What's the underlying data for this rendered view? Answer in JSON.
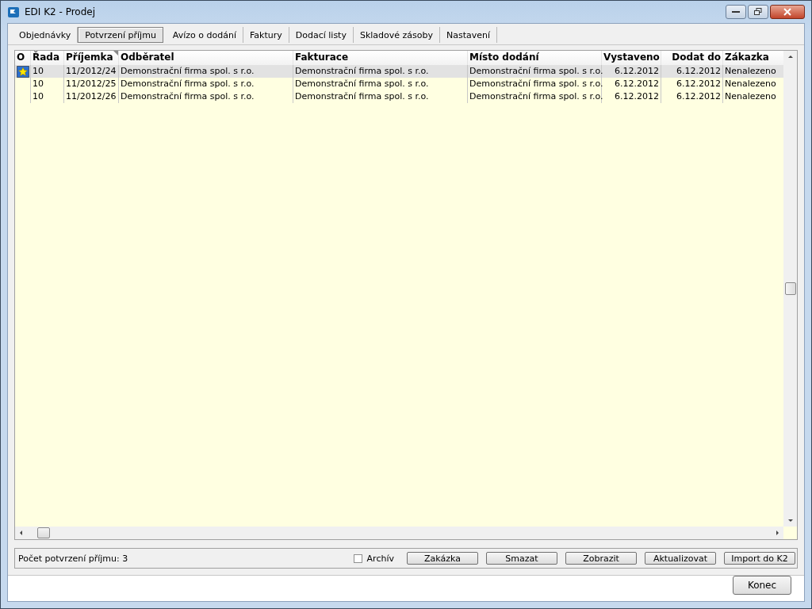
{
  "window": {
    "title": "EDI K2 - Prodej"
  },
  "tabs": [
    {
      "label": "Objednávky",
      "selected": false
    },
    {
      "label": "Potvrzení příjmu",
      "selected": true
    },
    {
      "label": "Avízo o dodání",
      "selected": false
    },
    {
      "label": "Faktury",
      "selected": false
    },
    {
      "label": "Dodací listy",
      "selected": false
    },
    {
      "label": "Skladové zásoby",
      "selected": false
    },
    {
      "label": "Nastavení",
      "selected": false
    }
  ],
  "table": {
    "columns": [
      "O",
      "Řada",
      "Příjemka",
      "Odběratel",
      "Fakturace",
      "Místo dodání",
      "Vystaveno",
      "Dodat do",
      "Zákazka"
    ],
    "rows": [
      {
        "selected": true,
        "cells": [
          "",
          "10",
          "11/2012/24",
          "Demonstrační firma spol. s r.o.",
          "Demonstrační firma spol. s r.o.",
          "Demonstrační firma spol. s r.o.",
          "6.12.2012",
          "6.12.2012",
          "Nenalezeno"
        ]
      },
      {
        "selected": false,
        "cells": [
          "",
          "10",
          "11/2012/25",
          "Demonstrační firma spol. s r.o.",
          "Demonstrační firma spol. s r.o.",
          "Demonstrační firma spol. s r.o.",
          "6.12.2012",
          "6.12.2012",
          "Nenalezeno"
        ]
      },
      {
        "selected": false,
        "cells": [
          "",
          "10",
          "11/2012/26",
          "Demonstrační firma spol. s r.o.",
          "Demonstrační firma spol. s r.o.",
          "Demonstrační firma spol. s r.o.",
          "6.12.2012",
          "6.12.2012",
          "Nenalezeno"
        ]
      }
    ]
  },
  "status_bar": {
    "count": "Počet potvrzení příjmu: 3",
    "archive": {
      "label": "Archív",
      "checked": false
    },
    "buttons": [
      "Zakázka",
      "Smazat",
      "Zobrazit",
      "Aktualizovat",
      "Import do K2"
    ]
  },
  "footer": {
    "buttons": [
      "Konec"
    ]
  }
}
